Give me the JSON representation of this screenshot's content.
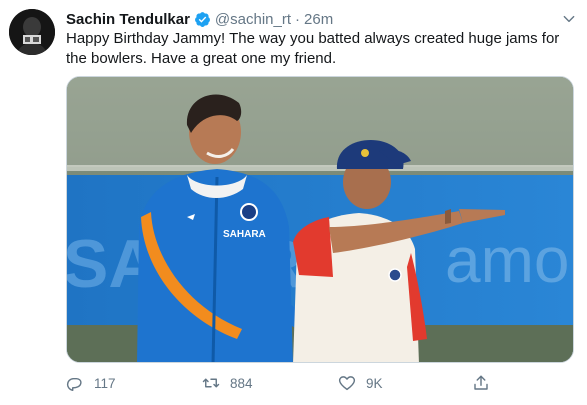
{
  "tweet": {
    "author_name": "Sachin Tendulkar",
    "handle": "@sachin_rt",
    "separator": "·",
    "time": "26m",
    "text": "Happy Birthday Jammy! The way you batted always created huge jams for the bowlers. Have a great one my friend.",
    "verified_icon": "verified-badge-icon",
    "menu_icon": "chevron-down-icon",
    "media": {
      "banner_left": "SAHARA",
      "jersey_text": "SAHARA",
      "board_right": "amo"
    }
  },
  "actions": {
    "reply": {
      "icon": "reply-icon",
      "count": "117"
    },
    "retweet": {
      "icon": "retweet-icon",
      "count": "884"
    },
    "like": {
      "icon": "heart-icon",
      "count": "9K"
    },
    "share": {
      "icon": "share-icon"
    }
  },
  "colors": {
    "text_primary": "#14171a",
    "text_secondary": "#657786",
    "verified": "#1da1f2",
    "border": "#ccd6dd"
  }
}
